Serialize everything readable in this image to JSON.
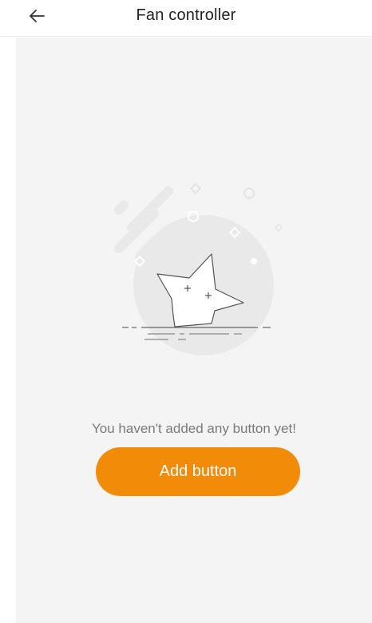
{
  "header": {
    "title": "Fan controller",
    "back_icon": "arrow-left-icon"
  },
  "empty_state": {
    "illustration_icon": "empty-star-illustration",
    "message": "You haven't added any button yet!",
    "add_button_label": "Add button"
  },
  "colors": {
    "accent": "#f28c08",
    "background": "#f4f4f4",
    "message_text": "#7a7a7a",
    "title_text": "#222222"
  }
}
